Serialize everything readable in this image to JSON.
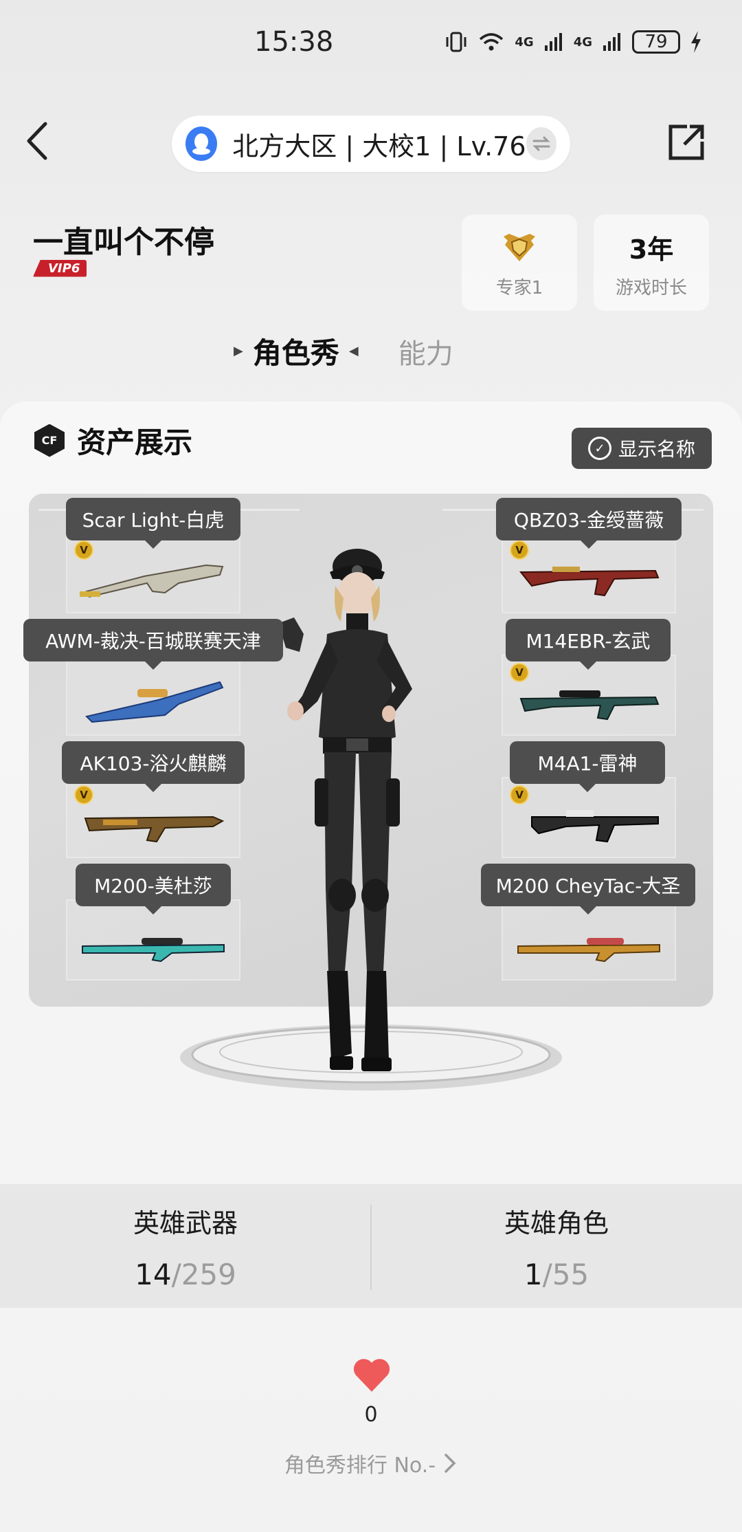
{
  "status_bar": {
    "time": "15:38",
    "net_1": "4G",
    "net_2": "4G",
    "battery": "79"
  },
  "header": {
    "server": "北方大区 | 大校1 | Lv.76"
  },
  "player": {
    "name": "一直叫个不停",
    "vip": "VIP6",
    "rank_label": "专家1",
    "duration_value": "3年",
    "duration_label": "游戏时长"
  },
  "tabs": {
    "active": "角色秀",
    "inactive": "能力"
  },
  "assets": {
    "title": "资产展示",
    "cf_logo": "CF",
    "show_name_label": "显示名称",
    "weapons_left": [
      {
        "name": "Scar Light-白虎",
        "badge": "V",
        "color": "#c8c4b4"
      },
      {
        "name": "AWM-裁决-百城联赛天津",
        "badge": "",
        "color": "#3c6fbd"
      },
      {
        "name": "AK103-浴火麒麟",
        "badge": "V",
        "color": "#7a5a2a"
      },
      {
        "name": "M200-美杜莎",
        "badge": "",
        "color": "#3ab8b0"
      }
    ],
    "weapons_right": [
      {
        "name": "QBZ03-金绶蔷薇",
        "badge": "V",
        "color": "#8a2a22"
      },
      {
        "name": "M14EBR-玄武",
        "badge": "V",
        "color": "#2c5450"
      },
      {
        "name": "M4A1-雷神",
        "badge": "V",
        "color": "#2a2a2a"
      },
      {
        "name": "M200 CheyTac-大圣",
        "badge": "",
        "color": "#c9902f"
      }
    ]
  },
  "stats": {
    "hero_weapons_label": "英雄武器",
    "hero_weapons_count": "14",
    "hero_weapons_total": "/259",
    "hero_roles_label": "英雄角色",
    "hero_roles_count": "1",
    "hero_roles_total": "/55"
  },
  "likes": {
    "count": "0",
    "ranking": "角色秀排行 No.-"
  },
  "colors": {
    "heart": "#ee5a5a",
    "tooltip": "#4e4e4e",
    "qq": "#3a7cf3"
  }
}
